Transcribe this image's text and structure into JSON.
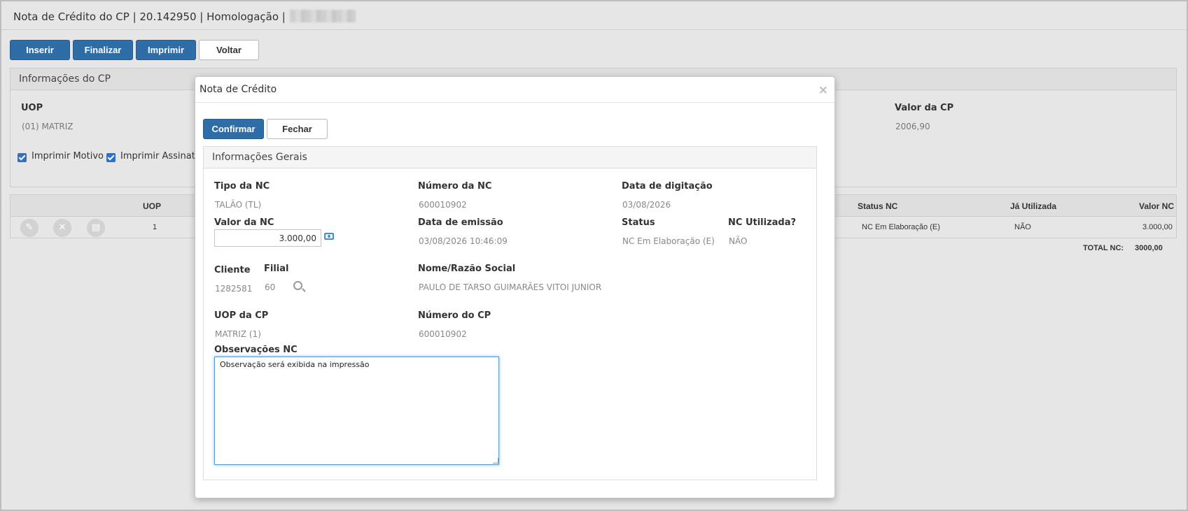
{
  "page": {
    "title": "Nota de Crédito do CP | 20.142950 | Homologação |",
    "toolbar": {
      "inserir": "Inserir",
      "finalizar": "Finalizar",
      "imprimir": "Imprimir",
      "voltar": "Voltar"
    }
  },
  "cp_info": {
    "header": "Informações do CP",
    "uop_label": "UOP",
    "uop_value": "(01) MATRIZ",
    "valor_label": "Valor da CP",
    "valor_value": "2006,90",
    "imprimir_motivo": "Imprimir Motivo",
    "imprimir_assinatura": "Imprimir Assinatu"
  },
  "nc_table": {
    "headers": {
      "uop": "UOP",
      "status": "Status NC",
      "ja_utilizada": "Já Utilizada",
      "valor": "Valor NC"
    },
    "rows": [
      {
        "uop": "1",
        "status": "NC Em Elaboração (E)",
        "ja_utilizada": "NÃO",
        "valor": "3.000,00"
      }
    ],
    "total_label": "TOTAL NC:",
    "total_value": "3000,00"
  },
  "modal": {
    "title": "Nota de Crédito",
    "close": "×",
    "confirmar": "Confirmar",
    "fechar": "Fechar",
    "panel_header": "Informações Gerais",
    "tipo_nc_label": "Tipo da NC",
    "tipo_nc_value": "TALÃO (TL)",
    "numero_nc_label": "Número da NC",
    "numero_nc_value": "600010902",
    "data_digitacao_label": "Data de digitação",
    "data_digitacao_value": "03/08/2026",
    "valor_nc_label": "Valor da NC",
    "valor_nc_value": "3.000,00",
    "data_emissao_label": "Data de emissão",
    "data_emissao_value": "03/08/2026 10:46:09",
    "status_label": "Status",
    "status_value": "NC Em Elaboração (E)",
    "nc_utilizada_label": "NC Utilizada?",
    "nc_utilizada_value": "NÃO",
    "cliente_label": "Cliente",
    "cliente_value": "1282581",
    "filial_label": "Filial",
    "filial_value": "60",
    "nome_label": "Nome/Razão Social",
    "nome_value": "PAULO DE TARSO GUIMARÃES VITOI JUNIOR",
    "uop_cp_label": "UOP da CP",
    "uop_cp_value": "MATRIZ (1)",
    "numero_cp_label": "Número do CP",
    "numero_cp_value": "600010902",
    "obs_label": "Observações NC",
    "obs_value": "Observação será exibida na impressão"
  },
  "colors": {
    "primary": "#2f6da8",
    "focus": "#5b9bd5",
    "checkbox": "#2e72c8"
  }
}
